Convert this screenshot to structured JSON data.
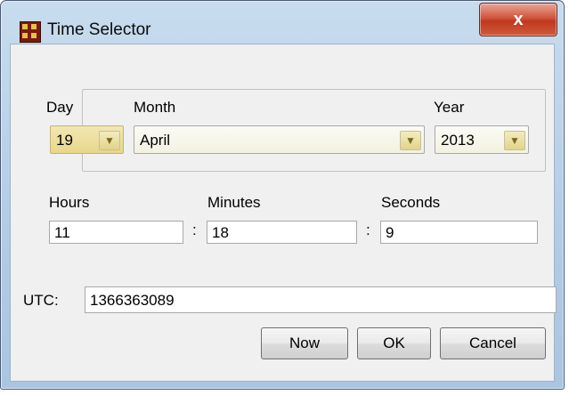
{
  "window": {
    "title": "Time Selector",
    "close_glyph": "x"
  },
  "date": {
    "day_label": "Day",
    "month_label": "Month",
    "year_label": "Year",
    "day_value": "19",
    "month_value": "April",
    "year_value": "2013"
  },
  "time": {
    "hours_label": "Hours",
    "minutes_label": "Minutes",
    "seconds_label": "Seconds",
    "hours_value": "11",
    "minutes_value": "18",
    "seconds_value": "9",
    "separator": ":"
  },
  "utc": {
    "label": "UTC:",
    "value": "1366363089"
  },
  "buttons": {
    "now": "Now",
    "ok": "OK",
    "cancel": "Cancel"
  },
  "icons": {
    "app": "app-icon",
    "close": "close-icon",
    "dropdown": "chevron-down-icon"
  }
}
